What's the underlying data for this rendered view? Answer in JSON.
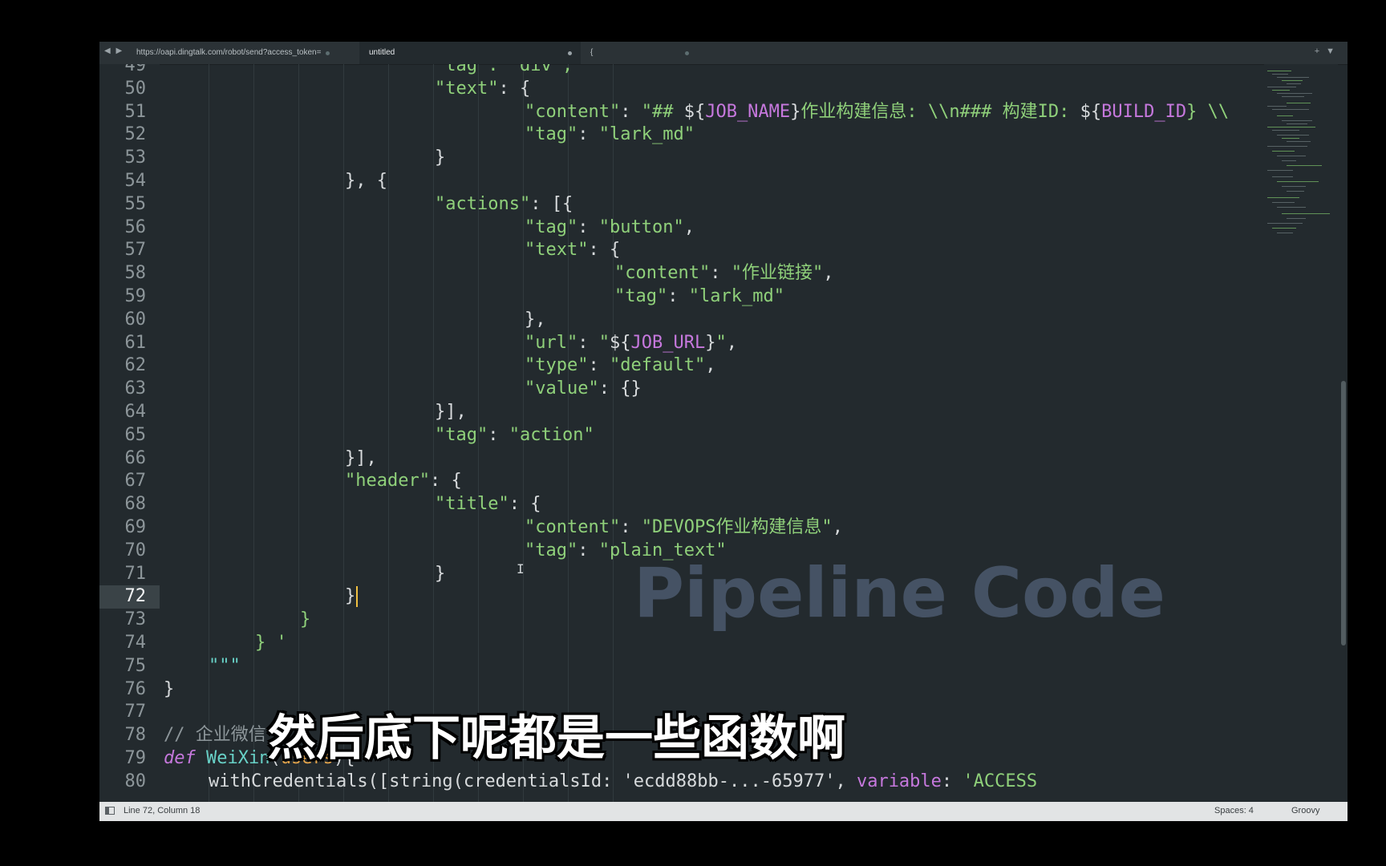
{
  "tabs": [
    {
      "label": "https://oapi.dingtalk.com/robot/send?access_token=",
      "active": false
    },
    {
      "label": "untitled",
      "active": true
    },
    {
      "label": "{",
      "active": false
    }
  ],
  "editor": {
    "current_line": 72,
    "lines": [
      {
        "n": "49",
        "tokens": [
          {
            "t": "\"tag\": \"div\",",
            "c": "str"
          }
        ]
      },
      {
        "n": "50",
        "tokens": [
          {
            "t": "\"text\"",
            "c": "str"
          },
          {
            "t": ": {",
            "c": "punc"
          }
        ]
      },
      {
        "n": "51",
        "tokens": [
          {
            "t": "\"content\"",
            "c": "str"
          },
          {
            "t": ": ",
            "c": "punc"
          },
          {
            "t": "\"## ",
            "c": "str"
          },
          {
            "t": "${",
            "c": "punc"
          },
          {
            "t": "JOB_NAME",
            "c": "var"
          },
          {
            "t": "}",
            "c": "punc"
          },
          {
            "t": "作业构建信息: \\\\n### 构建ID: ",
            "c": "str"
          },
          {
            "t": "${",
            "c": "punc"
          },
          {
            "t": "BUILD_ID",
            "c": "var"
          },
          {
            "t": "} \\\\",
            "c": "str"
          }
        ]
      },
      {
        "n": "52",
        "tokens": [
          {
            "t": "\"tag\"",
            "c": "str"
          },
          {
            "t": ": ",
            "c": "punc"
          },
          {
            "t": "\"lark_md\"",
            "c": "str"
          }
        ]
      },
      {
        "n": "53",
        "tokens": [
          {
            "t": "}",
            "c": "punc"
          }
        ]
      },
      {
        "n": "54",
        "tokens": [
          {
            "t": "}, {",
            "c": "punc"
          }
        ]
      },
      {
        "n": "55",
        "tokens": [
          {
            "t": "\"actions\"",
            "c": "str"
          },
          {
            "t": ": [{",
            "c": "punc"
          }
        ]
      },
      {
        "n": "56",
        "tokens": [
          {
            "t": "\"tag\"",
            "c": "str"
          },
          {
            "t": ": ",
            "c": "punc"
          },
          {
            "t": "\"button\"",
            "c": "str"
          },
          {
            "t": ",",
            "c": "punc"
          }
        ]
      },
      {
        "n": "57",
        "tokens": [
          {
            "t": "\"text\"",
            "c": "str"
          },
          {
            "t": ": {",
            "c": "punc"
          }
        ]
      },
      {
        "n": "58",
        "tokens": [
          {
            "t": "\"content\"",
            "c": "str"
          },
          {
            "t": ": ",
            "c": "punc"
          },
          {
            "t": "\"作业链接\"",
            "c": "str"
          },
          {
            "t": ",",
            "c": "punc"
          }
        ]
      },
      {
        "n": "59",
        "tokens": [
          {
            "t": "\"tag\"",
            "c": "str"
          },
          {
            "t": ": ",
            "c": "punc"
          },
          {
            "t": "\"lark_md\"",
            "c": "str"
          }
        ]
      },
      {
        "n": "60",
        "tokens": [
          {
            "t": "},",
            "c": "punc"
          }
        ]
      },
      {
        "n": "61",
        "tokens": [
          {
            "t": "\"url\"",
            "c": "str"
          },
          {
            "t": ": ",
            "c": "punc"
          },
          {
            "t": "\"",
            "c": "str"
          },
          {
            "t": "${",
            "c": "punc"
          },
          {
            "t": "JOB_URL",
            "c": "var"
          },
          {
            "t": "}",
            "c": "punc"
          },
          {
            "t": "\"",
            "c": "str"
          },
          {
            "t": ",",
            "c": "punc"
          }
        ]
      },
      {
        "n": "62",
        "tokens": [
          {
            "t": "\"type\"",
            "c": "str"
          },
          {
            "t": ": ",
            "c": "punc"
          },
          {
            "t": "\"default\"",
            "c": "str"
          },
          {
            "t": ",",
            "c": "punc"
          }
        ]
      },
      {
        "n": "63",
        "tokens": [
          {
            "t": "\"value\"",
            "c": "str"
          },
          {
            "t": ": {}",
            "c": "punc"
          }
        ]
      },
      {
        "n": "64",
        "tokens": [
          {
            "t": "}],",
            "c": "punc"
          }
        ]
      },
      {
        "n": "65",
        "tokens": [
          {
            "t": "\"tag\"",
            "c": "str"
          },
          {
            "t": ": ",
            "c": "punc"
          },
          {
            "t": "\"action\"",
            "c": "str"
          }
        ]
      },
      {
        "n": "66",
        "tokens": [
          {
            "t": "}],",
            "c": "punc"
          }
        ]
      },
      {
        "n": "67",
        "tokens": [
          {
            "t": "\"header\"",
            "c": "str"
          },
          {
            "t": ": {",
            "c": "punc"
          }
        ]
      },
      {
        "n": "68",
        "tokens": [
          {
            "t": "\"title\"",
            "c": "str"
          },
          {
            "t": ": {",
            "c": "punc"
          }
        ]
      },
      {
        "n": "69",
        "tokens": [
          {
            "t": "\"content\"",
            "c": "str"
          },
          {
            "t": ": ",
            "c": "punc"
          },
          {
            "t": "\"DEVOPS作业构建信息\"",
            "c": "str"
          },
          {
            "t": ",",
            "c": "punc"
          }
        ]
      },
      {
        "n": "70",
        "tokens": [
          {
            "t": "\"tag\"",
            "c": "str"
          },
          {
            "t": ": ",
            "c": "punc"
          },
          {
            "t": "\"plain_text\"",
            "c": "str"
          }
        ]
      },
      {
        "n": "71",
        "tokens": [
          {
            "t": "}",
            "c": "punc"
          }
        ]
      },
      {
        "n": "72",
        "tokens": [
          {
            "t": "}",
            "c": "punc"
          }
        ]
      },
      {
        "n": "73",
        "tokens": [
          {
            "t": "}",
            "c": "str"
          }
        ]
      },
      {
        "n": "74",
        "tokens": [
          {
            "t": "} '",
            "c": "str"
          }
        ]
      },
      {
        "n": "75",
        "tokens": [
          {
            "t": "\"\"\"",
            "c": "fn"
          }
        ]
      },
      {
        "n": "76",
        "tokens": [
          {
            "t": "}",
            "c": "punc"
          }
        ]
      },
      {
        "n": "77",
        "tokens": []
      },
      {
        "n": "78",
        "tokens": [
          {
            "t": "// 企业微信",
            "c": "cmt"
          }
        ]
      },
      {
        "n": "79",
        "tokens": [
          {
            "t": "def",
            "c": "kw"
          },
          {
            "t": " ",
            "c": "punc"
          },
          {
            "t": "WeiXin",
            "c": "fn"
          },
          {
            "t": "(",
            "c": "punc"
          },
          {
            "t": "users",
            "c": "param"
          },
          {
            "t": "){",
            "c": "punc"
          }
        ]
      },
      {
        "n": "80",
        "tokens": [
          {
            "t": "withCredentials([string(credentialsId: 'ecdd88bb-...-65977', ",
            "c": "punc"
          },
          {
            "t": "variable",
            "c": "var"
          },
          {
            "t": ": ",
            "c": "punc"
          },
          {
            "t": "'ACCESS",
            "c": "str"
          }
        ]
      }
    ]
  },
  "watermark": "Pipeline Code",
  "subtitle": "然后底下呢都是一些函数啊",
  "status": {
    "position": "Line 72, Column 18",
    "spaces": "Spaces: 4",
    "syntax": "Groovy"
  }
}
